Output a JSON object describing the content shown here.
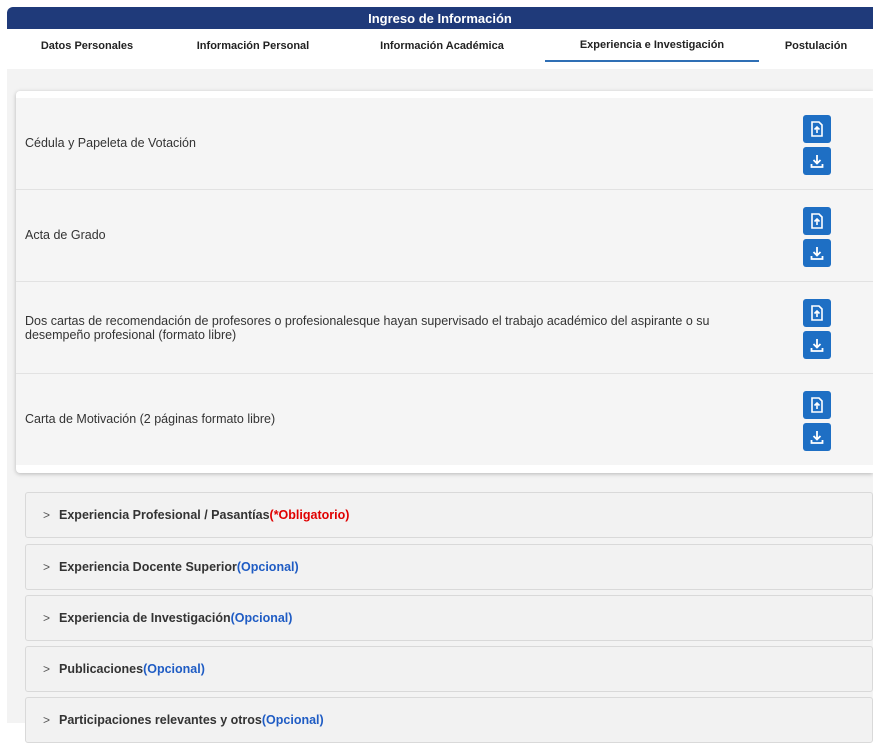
{
  "header": {
    "title": "Ingreso de Información"
  },
  "tabs": [
    {
      "label": "Datos Personales"
    },
    {
      "label": "Información Personal"
    },
    {
      "label": "Información Académica"
    },
    {
      "label": "Experiencia e Investigación",
      "active": true
    },
    {
      "label": "Postulación"
    }
  ],
  "documents": [
    {
      "label": "Cédula y Papeleta de Votación"
    },
    {
      "label": "Acta de Grado"
    },
    {
      "label": "Dos cartas de recomendación de profesores o profesionalesque hayan supervisado el trabajo académico del aspirante o su desempeño profesional (formato libre)"
    },
    {
      "label": "Carta de Motivación (2 páginas formato libre)"
    }
  ],
  "icons": {
    "upload": "file-upload-icon",
    "download": "download-icon",
    "chevron": "chevron-right-icon"
  },
  "colors": {
    "header_bg": "#1f3a7a",
    "button_bg": "#1e6fc4",
    "required": "#e00000",
    "optional": "#1f5cc4",
    "tab_underline": "#2f6fb5"
  },
  "sections": [
    {
      "title": "Experiencia Profesional / Pasantías",
      "tag": "(*Obligatorio)",
      "tag_type": "required"
    },
    {
      "title": "Experiencia Docente Superior",
      "tag": "(Opcional)",
      "tag_type": "optional"
    },
    {
      "title": "Experiencia de Investigación",
      "tag": "(Opcional)",
      "tag_type": "optional"
    },
    {
      "title": "Publicaciones",
      "tag": "(Opcional)",
      "tag_type": "optional"
    },
    {
      "title": "Participaciones relevantes y otros",
      "tag": "(Opcional)",
      "tag_type": "optional"
    }
  ],
  "chevron_glyph": ">"
}
